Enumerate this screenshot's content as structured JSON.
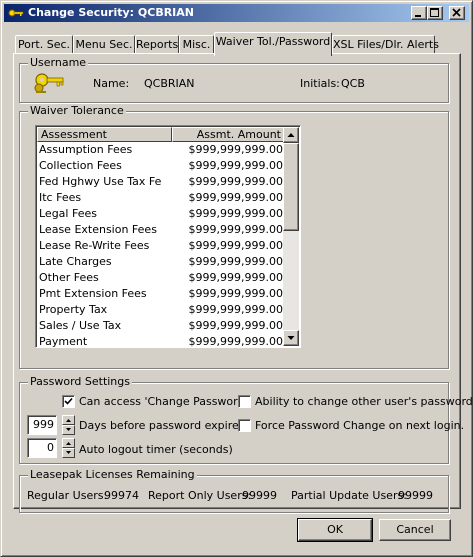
{
  "window": {
    "title": "Change Security: QCBRIAN"
  },
  "tabs": [
    {
      "label": "Port. Sec."
    },
    {
      "label": "Menu Sec."
    },
    {
      "label": "Reports"
    },
    {
      "label": "Misc."
    },
    {
      "label": "Waiver Tol./Password",
      "active": true
    },
    {
      "label": "XSL Files/Dlr. Alerts"
    }
  ],
  "username_group": {
    "title": "Username",
    "name_label": "Name:",
    "name_value": "QCBRIAN",
    "initials_label": "Initials:",
    "initials_value": "QCB",
    "icon": "keys-icon"
  },
  "waiver_group": {
    "title": "Waiver Tolerance",
    "columns": [
      "Assessment",
      "Assmt. Amount"
    ],
    "rows": [
      {
        "assessment": "Assumption Fees",
        "amount": "$999,999,999.00"
      },
      {
        "assessment": "Collection Fees",
        "amount": "$999,999,999.00"
      },
      {
        "assessment": "Fed Hghwy Use Tax Fe",
        "amount": "$999,999,999.00"
      },
      {
        "assessment": "Itc Fees",
        "amount": "$999,999,999.00"
      },
      {
        "assessment": "Legal Fees",
        "amount": "$999,999,999.00"
      },
      {
        "assessment": "Lease Extension Fees",
        "amount": "$999,999,999.00"
      },
      {
        "assessment": "Lease Re-Write Fees",
        "amount": "$999,999,999.00"
      },
      {
        "assessment": "Late Charges",
        "amount": "$999,999,999.00"
      },
      {
        "assessment": "Other Fees",
        "amount": "$999,999,999.00"
      },
      {
        "assessment": "Pmt Extension Fees",
        "amount": "$999,999,999.00"
      },
      {
        "assessment": "Property Tax",
        "amount": "$999,999,999.00"
      },
      {
        "assessment": "Sales / Use Tax",
        "amount": "$999,999,999.00"
      },
      {
        "assessment": "Payment",
        "amount": "$999,999,999.00"
      }
    ]
  },
  "password_group": {
    "title": "Password Settings",
    "can_access_change_password": {
      "label": "Can access 'Change Password'",
      "checked": true
    },
    "ability_change_others": {
      "label": "Ability to change other user's passwords",
      "checked": false
    },
    "days_before_expire": {
      "value": "999",
      "label": "Days before password expires"
    },
    "force_change": {
      "label": "Force Password Change on next login.",
      "checked": false
    },
    "auto_logout": {
      "value": "0",
      "label": "Auto logout timer (seconds)"
    }
  },
  "licenses_group": {
    "title": "Leasepak Licenses Remaining",
    "regular_label": "Regular Users:",
    "regular_value": "99974",
    "report_label": "Report Only Users:",
    "report_value": "99999",
    "partial_label": "Partial Update Users:",
    "partial_value": "99999"
  },
  "buttons": {
    "ok": "OK",
    "cancel": "Cancel"
  }
}
